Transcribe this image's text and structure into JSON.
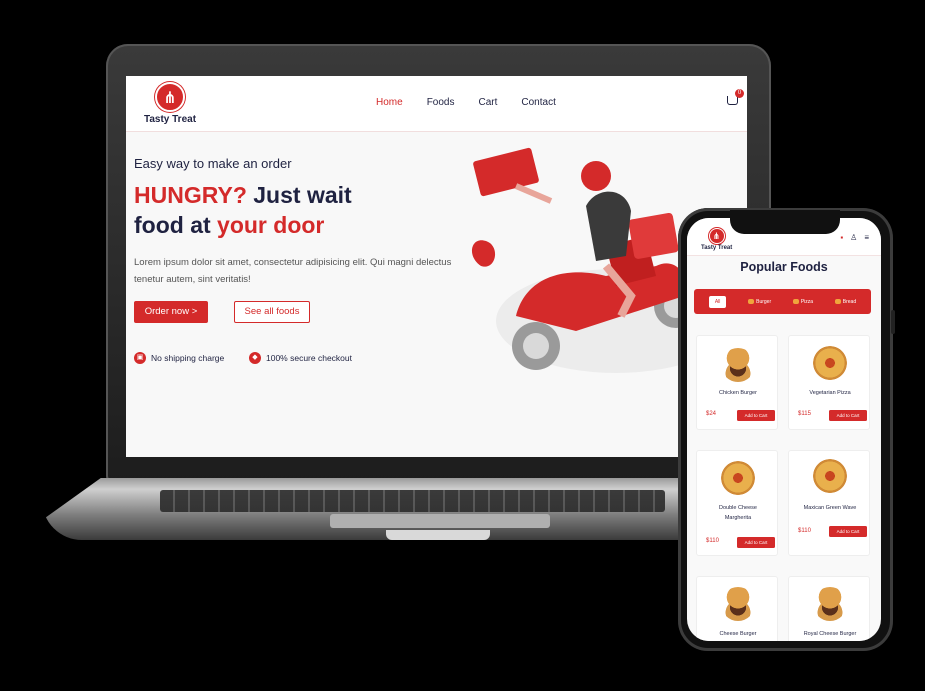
{
  "brand": {
    "name": "Tasty Treat",
    "accent": "#d42a2a",
    "text": "#1f2241"
  },
  "desktop": {
    "nav": {
      "items": [
        "Home",
        "Foods",
        "Cart",
        "Contact"
      ],
      "active": "Home",
      "cart_count": "0"
    },
    "hero": {
      "tagline": "Easy way to make an order",
      "headline_red1": "HUNGRY?",
      "headline_dark1": " Just wait",
      "headline_dark2": "food at ",
      "headline_red2": "your door",
      "body": "Lorem ipsum dolor sit amet, consectetur adipisicing elit. Qui magni delectus tenetur autem, sint veritatis!",
      "btn_order": "Order now >",
      "btn_all": "See all foods",
      "feature1": "No shipping charge",
      "feature2": "100% secure checkout"
    }
  },
  "mobile": {
    "nav": {
      "cart_count": "0"
    },
    "title": "Popular Foods",
    "tabs": [
      "All",
      "Burger",
      "Pizza",
      "Bread"
    ],
    "products": [
      {
        "name": "Chicken Burger",
        "price": "$24",
        "kind": "burger"
      },
      {
        "name": "Vegetarian Pizza",
        "price": "$115",
        "kind": "pizza"
      },
      {
        "name": "Double Cheese Margherita",
        "price": "$110",
        "kind": "pizza"
      },
      {
        "name": "Maxican Green Wave",
        "price": "$110",
        "kind": "pizza"
      },
      {
        "name": "Cheese Burger",
        "price": "",
        "kind": "burger"
      },
      {
        "name": "Royal Cheese Burger",
        "price": "",
        "kind": "burger"
      }
    ],
    "add_label": "Add to Cart"
  }
}
